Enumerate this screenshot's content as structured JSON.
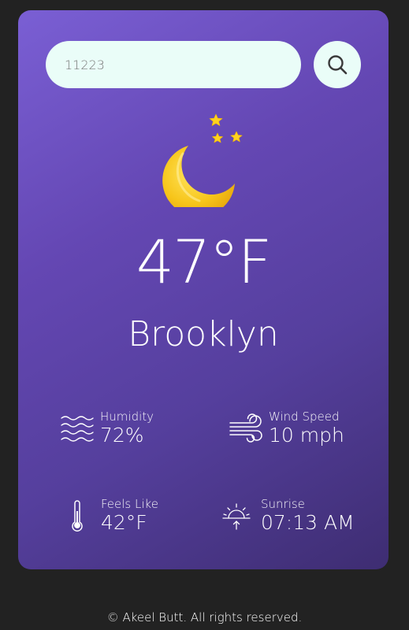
{
  "search": {
    "value": "11223",
    "button_icon": "search-icon"
  },
  "weather": {
    "icon": "moon-stars-icon",
    "temperature": "47°F",
    "city": "Brooklyn"
  },
  "stats": {
    "humidity": {
      "label": "Humidity",
      "value": "72%",
      "icon": "humidity-waves-icon"
    },
    "wind": {
      "label": "Wind Speed",
      "value": "10 mph",
      "icon": "wind-icon"
    },
    "feels_like": {
      "label": "Feels Like",
      "value": "42°F",
      "icon": "thermometer-icon"
    },
    "sunrise": {
      "label": "Sunrise",
      "value": "07:13 AM",
      "icon": "sunrise-icon"
    }
  },
  "footer": {
    "text": "© Akeel Butt. All rights reserved."
  },
  "colors": {
    "page_background": "#222222",
    "card_gradient_start": "#7a5fd4",
    "card_gradient_end": "#3e2d72",
    "input_background": "#eafdf8",
    "moon": "#f7c51a",
    "star": "#ffd21f"
  }
}
